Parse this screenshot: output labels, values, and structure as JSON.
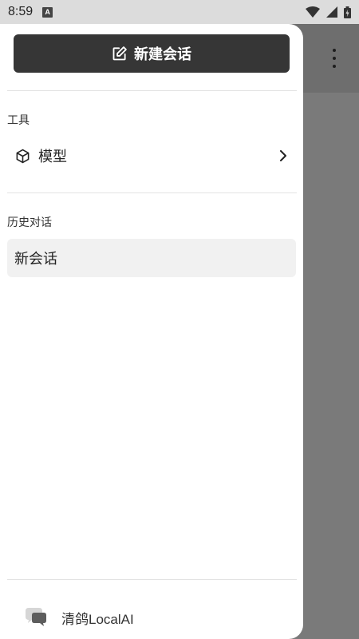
{
  "status_bar": {
    "time": "8:59",
    "notification_badge": "A"
  },
  "drawer": {
    "new_chat_label": "新建会话",
    "tools_section_label": "工具",
    "tools_items": [
      {
        "label": "模型",
        "icon": "cube-icon"
      }
    ],
    "history_section_label": "历史对话",
    "history_items": [
      {
        "label": "新会话"
      }
    ],
    "footer_app_name": "清鸽LocalAI"
  },
  "colors": {
    "button_bg": "#363636",
    "scrim": "#7a7a7a",
    "status_bar_bg": "#dcdcdc",
    "history_item_bg": "#f1f1f1"
  }
}
